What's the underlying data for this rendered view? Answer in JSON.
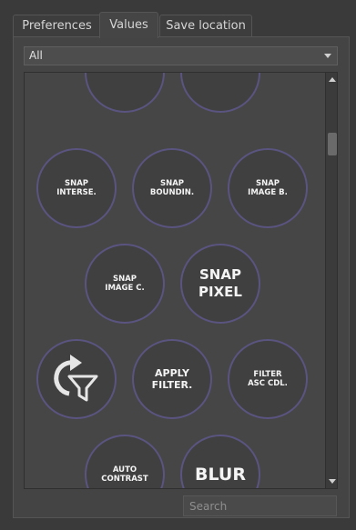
{
  "tabs": [
    {
      "label": "Preferences",
      "active": false
    },
    {
      "label": "Values",
      "active": true
    },
    {
      "label": "Save location",
      "active": false
    }
  ],
  "filter": {
    "selected": "All"
  },
  "buttons": [
    {
      "label": ""
    },
    {
      "label": ""
    },
    {
      "label": "SNAP\nINTERSE."
    },
    {
      "label": "SNAP\nBOUNDIN."
    },
    {
      "label": "SNAP\nIMAGE B."
    },
    {
      "label": "SNAP\nIMAGE C."
    },
    {
      "label": "SNAP\nPIXEL"
    },
    {
      "label": "",
      "icon": "reset-filter-icon"
    },
    {
      "label": "APPLY\nFILTER."
    },
    {
      "label": "FILTER\nASC CDL."
    },
    {
      "label": "AUTO\nCONTRAST"
    },
    {
      "label": "BLUR"
    }
  ],
  "search": {
    "placeholder": "Search",
    "value": ""
  },
  "colors": {
    "ring": "#5a5480",
    "background": "#3a3a3a"
  }
}
